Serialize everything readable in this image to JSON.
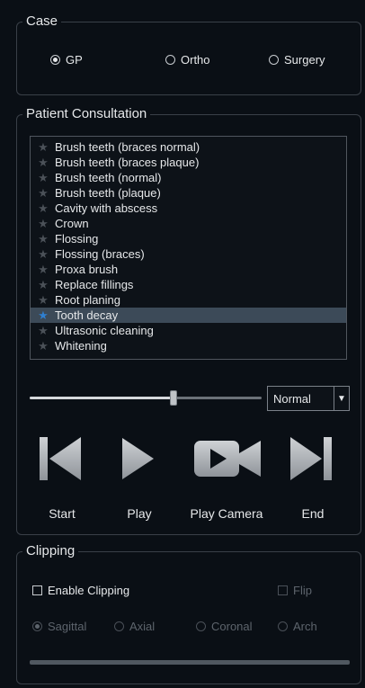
{
  "case": {
    "title": "Case",
    "options": [
      "GP",
      "Ortho",
      "Surgery"
    ],
    "selected": "GP"
  },
  "consultation": {
    "title": "Patient Consultation",
    "items": [
      "Brush teeth (braces normal)",
      "Brush teeth (braces plaque)",
      "Brush teeth (normal)",
      "Brush teeth (plaque)",
      "Cavity with abscess",
      "Crown",
      "Flossing",
      "Flossing (braces)",
      "Proxa brush",
      "Replace fillings",
      "Root planing",
      "Tooth decay",
      "Ultrasonic cleaning",
      "Whitening"
    ],
    "selected_index": 11,
    "slider_position": 0.62,
    "speed": "Normal",
    "buttons": {
      "start": "Start",
      "play": "Play",
      "play_camera": "Play Camera",
      "end": "End"
    }
  },
  "clipping": {
    "title": "Clipping",
    "enable_label": "Enable Clipping",
    "enable_checked": false,
    "flip_label": "Flip",
    "planes": [
      "Sagittal",
      "Axial",
      "Coronal",
      "Arch"
    ],
    "selected_plane": "Sagittal",
    "progress": 0
  },
  "icons": {
    "list_item": "star-icon",
    "start": "skip-back-icon",
    "play": "play-icon",
    "play_camera": "video-camera-icon",
    "end": "skip-forward-icon"
  },
  "colors": {
    "background": "#0a0f15",
    "selection": "#3c4a58",
    "selected_star": "#2f7fd0"
  }
}
